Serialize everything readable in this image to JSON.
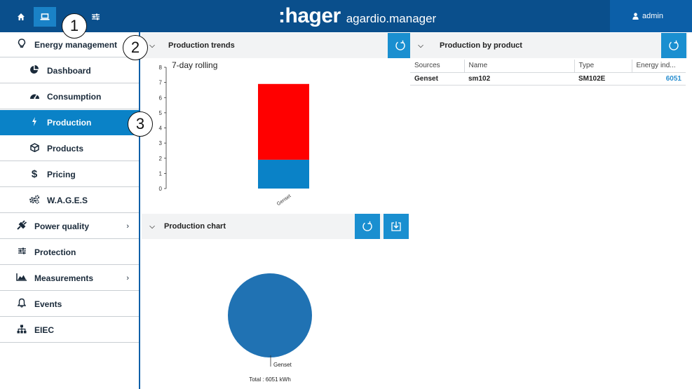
{
  "topbar": {
    "buttons": [
      {
        "icon": "home-icon"
      },
      {
        "icon": "laptop-icon"
      },
      {
        "icon": "sliders-icon"
      }
    ],
    "brand_logo": ":hager",
    "brand_app": "agardio.manager",
    "user_name": "admin"
  },
  "sidebar": {
    "items": [
      {
        "label": "Energy management",
        "icon": "lightbulb-icon"
      },
      {
        "label": "Dashboard",
        "icon": "pie-chart-icon"
      },
      {
        "label": "Consumption",
        "icon": "gauge-icon"
      },
      {
        "label": "Production",
        "icon": "bolt-icon"
      },
      {
        "label": "Products",
        "icon": "cube-icon"
      },
      {
        "label": "Pricing",
        "icon": "dollar-icon"
      },
      {
        "label": "W.A.G.E.S",
        "icon": "cogs-icon"
      },
      {
        "label": "Power quality",
        "icon": "plug-icon"
      },
      {
        "label": "Protection",
        "icon": "sliders-icon"
      },
      {
        "label": "Measurements",
        "icon": "area-chart-icon"
      },
      {
        "label": "Events",
        "icon": "bell-icon"
      },
      {
        "label": "EIEC",
        "icon": "sitemap-icon"
      }
    ],
    "chevron": "›"
  },
  "panels": {
    "trends_title": "Production trends",
    "by_product_title": "Production by product",
    "chart_title": "Production chart"
  },
  "table": {
    "headers": [
      "Sources",
      "Name",
      "Type",
      "Energy ind..."
    ],
    "rows": [
      [
        "Genset",
        "sm102",
        "SM102E",
        "6051"
      ]
    ]
  },
  "callouts": [
    "1",
    "2",
    "3"
  ],
  "colors": {
    "topbar": "#0a4f8c",
    "accent": "#0a82c7",
    "bar_top": "#ff0000",
    "bar_bottom": "#0a82c7",
    "pie": "#2072b3"
  },
  "chart_data": [
    {
      "type": "bar",
      "title": "7-day rolling",
      "categories": [
        "Genset"
      ],
      "series": [
        {
          "values": [
            1.9
          ],
          "color": "#0a82c7"
        },
        {
          "values": [
            5.0
          ],
          "color": "#ff0000"
        }
      ],
      "stacked": true,
      "ylim": [
        0,
        8
      ],
      "yticks": [
        0,
        1,
        2,
        3,
        4,
        5,
        6,
        7,
        8
      ]
    },
    {
      "type": "pie",
      "slices": [
        {
          "label": "Genset",
          "value": 6051
        }
      ],
      "total_label": "Total : 6051 kWh"
    }
  ]
}
